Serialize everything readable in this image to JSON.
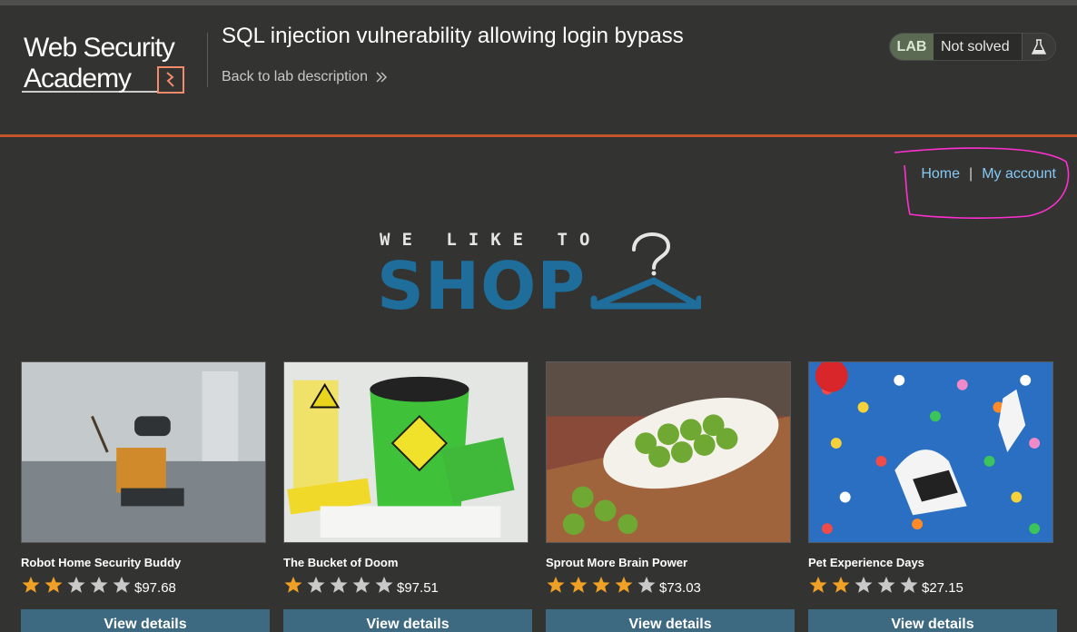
{
  "header": {
    "logo_line1": "Web Security",
    "logo_line2": "Academy",
    "title": "SQL injection vulnerability allowing login bypass",
    "back_link": "Back to lab description",
    "status_tag": "LAB",
    "status_text": "Not solved",
    "status_icon": "flask-icon"
  },
  "colors": {
    "accent_rule": "#c2562a",
    "link": "#86c9f5",
    "shop_blue": "#1f6d9a",
    "button": "#3d6a80",
    "star_filled": "#f0a024",
    "star_empty": "#c9c9c9",
    "scribble": "#ff2fd1"
  },
  "nav": {
    "home": "Home",
    "separator": "|",
    "account": "My account"
  },
  "banner": {
    "small": "WE LIKE TO",
    "big": "SHOP",
    "icon": "hanger-icon"
  },
  "products": [
    {
      "name": "Robot Home Security Buddy",
      "rating": 2,
      "price": "$97.68",
      "button": "View details"
    },
    {
      "name": "The Bucket of Doom",
      "rating": 1,
      "price": "$97.51",
      "button": "View details"
    },
    {
      "name": "Sprout More Brain Power",
      "rating": 4,
      "price": "$73.03",
      "button": "View details"
    },
    {
      "name": "Pet Experience Days",
      "rating": 2,
      "price": "$27.15",
      "button": "View details"
    }
  ]
}
